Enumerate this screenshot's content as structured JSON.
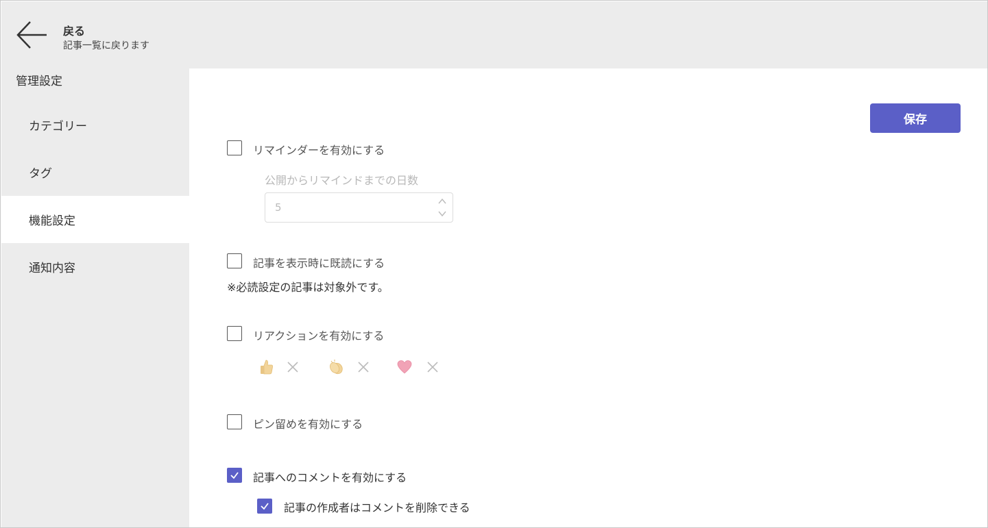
{
  "header": {
    "back_title": "戻る",
    "back_subtitle": "記事一覧に戻ります"
  },
  "sidebar": {
    "title": "管理設定",
    "items": [
      {
        "label": "カテゴリー",
        "active": false
      },
      {
        "label": "タグ",
        "active": false
      },
      {
        "label": "機能設定",
        "active": true
      },
      {
        "label": "通知内容",
        "active": false
      }
    ]
  },
  "toolbar": {
    "save_label": "保存"
  },
  "settings": {
    "reminder": {
      "label": "リマインダーを有効にする",
      "checked": false,
      "days_label": "公開からリマインドまでの日数",
      "days_value": "5"
    },
    "mark_read": {
      "label": "記事を表示時に既読にする",
      "checked": false,
      "note": "※必読設定の記事は対象外です。"
    },
    "reaction": {
      "label": "リアクションを有効にする",
      "checked": false,
      "items": [
        "thumbs-up",
        "clapping-hands",
        "heart"
      ]
    },
    "pin": {
      "label": "ピン留めを有効にする",
      "checked": false
    },
    "comment": {
      "label": "記事へのコメントを有効にする",
      "checked": true,
      "author_delete_label": "記事の作成者はコメントを削除できる",
      "author_delete_checked": true
    }
  },
  "colors": {
    "accent": "#5b5fc7",
    "sidebar_bg": "#ececec",
    "header_bg": "#ececec"
  }
}
